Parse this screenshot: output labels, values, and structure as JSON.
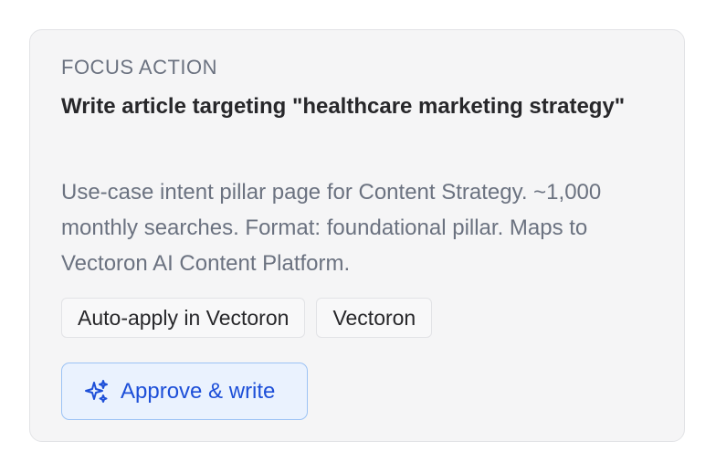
{
  "card": {
    "eyebrow": "FOCUS ACTION",
    "title": "Write article targeting \"healthcare marketing strategy\"",
    "description": "Use-case intent pillar page for Content Strategy. ~1,000 monthly searches. Format: foundational pillar. Maps to Vectoron AI Content Platform.",
    "tags": [
      {
        "label": "Auto-apply in Vectoron"
      },
      {
        "label": "Vectoron"
      }
    ],
    "approve_button": {
      "label": "Approve & write",
      "icon": "sparkles-icon"
    }
  },
  "colors": {
    "accent": "#1d4fd8",
    "button_bg": "#eaf2fe",
    "card_bg": "#f5f5f6"
  }
}
